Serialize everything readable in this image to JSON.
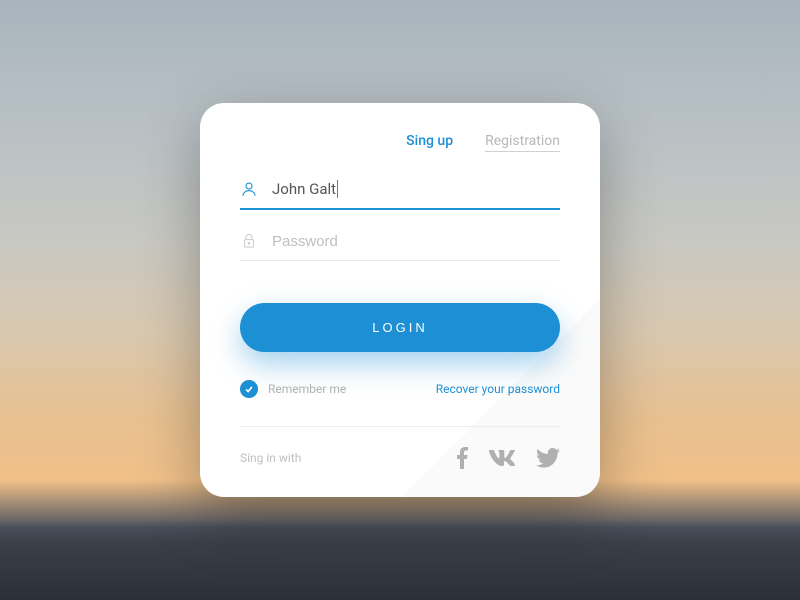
{
  "tabs": {
    "signup": "Sing up",
    "registration": "Registration"
  },
  "form": {
    "username_value": "John Galt",
    "password_placeholder": "Password"
  },
  "login_button": "LOGIN",
  "options": {
    "remember_label": "Remember me",
    "recover_label": "Recover your password"
  },
  "social": {
    "label": "Sing in with"
  }
}
